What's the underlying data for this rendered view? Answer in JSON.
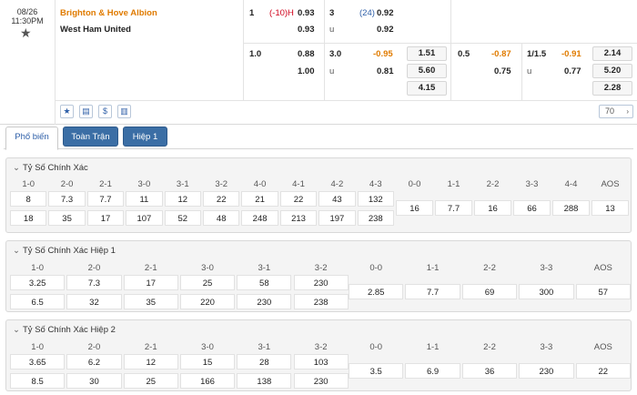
{
  "match": {
    "date": "08/26",
    "time": "11:30PM",
    "home": "Brighton & Hove Albion",
    "away": "West Ham United"
  },
  "ft": {
    "hdp_line": "1",
    "hdp_tag": "(-10)H",
    "hdp_home": "0.93",
    "hdp_away": "0.93",
    "ou_line": "3",
    "ou_tag": "(24)",
    "ou_over": "0.92",
    "ou_u": "u",
    "ou_under": "0.92",
    "r2_hdp_line": "1.0",
    "r2_hdp_home": "0.88",
    "r2_hdp_away": "1.00",
    "r2_ou_line": "3.0",
    "r2_ou_over": "-0.95",
    "r2_ou_u": "u",
    "r2_ou_under": "0.81",
    "x12": [
      "1.51",
      "5.60",
      "4.15"
    ]
  },
  "h1": {
    "hdp_line": "0.5",
    "hdp_home": "-0.87",
    "hdp_away": "0.75",
    "ou_line": "1/1.5",
    "ou_over": "-0.91",
    "ou_u": "u",
    "ou_under": "0.77",
    "x12": [
      "2.14",
      "5.20",
      "2.28"
    ]
  },
  "toolbar": {
    "more_count": "70",
    "icons": [
      "star-icon",
      "scoreboard-icon",
      "dollar-icon",
      "stats-icon"
    ]
  },
  "tabs": [
    "Phổ biến",
    "Toàn Trận",
    "Hiệp 1"
  ],
  "sections": [
    {
      "title": "Tỷ Số Chính Xác",
      "home_headers": [
        "1-0",
        "2-0",
        "2-1",
        "3-0",
        "3-1",
        "3-2",
        "4-0",
        "4-1",
        "4-2",
        "4-3"
      ],
      "home_row1": [
        "8",
        "7.3",
        "7.7",
        "11",
        "12",
        "22",
        "21",
        "22",
        "43",
        "132"
      ],
      "home_row2": [
        "18",
        "35",
        "17",
        "107",
        "52",
        "48",
        "248",
        "213",
        "197",
        "238"
      ],
      "draw_headers": [
        "0-0",
        "1-1",
        "2-2",
        "3-3",
        "4-4",
        "AOS"
      ],
      "draw_vals": [
        "16",
        "7.7",
        "16",
        "66",
        "288",
        "13"
      ]
    },
    {
      "title": "Tỷ Số Chính Xác Hiệp 1",
      "home_headers": [
        "1-0",
        "2-0",
        "2-1",
        "3-0",
        "3-1",
        "3-2"
      ],
      "home_row1": [
        "3.25",
        "7.3",
        "17",
        "25",
        "58",
        "230"
      ],
      "home_row2": [
        "6.5",
        "32",
        "35",
        "220",
        "230",
        "238"
      ],
      "draw_headers": [
        "0-0",
        "1-1",
        "2-2",
        "3-3",
        "AOS"
      ],
      "draw_vals": [
        "2.85",
        "7.7",
        "69",
        "300",
        "57"
      ]
    },
    {
      "title": "Tỷ Số Chính Xác Hiệp 2",
      "home_headers": [
        "1-0",
        "2-0",
        "2-1",
        "3-0",
        "3-1",
        "3-2"
      ],
      "home_row1": [
        "3.65",
        "6.2",
        "12",
        "15",
        "28",
        "103"
      ],
      "home_row2": [
        "8.5",
        "30",
        "25",
        "166",
        "138",
        "230"
      ],
      "draw_headers": [
        "0-0",
        "1-1",
        "2-2",
        "3-3",
        "AOS"
      ],
      "draw_vals": [
        "3.5",
        "6.9",
        "36",
        "230",
        "22"
      ]
    }
  ]
}
